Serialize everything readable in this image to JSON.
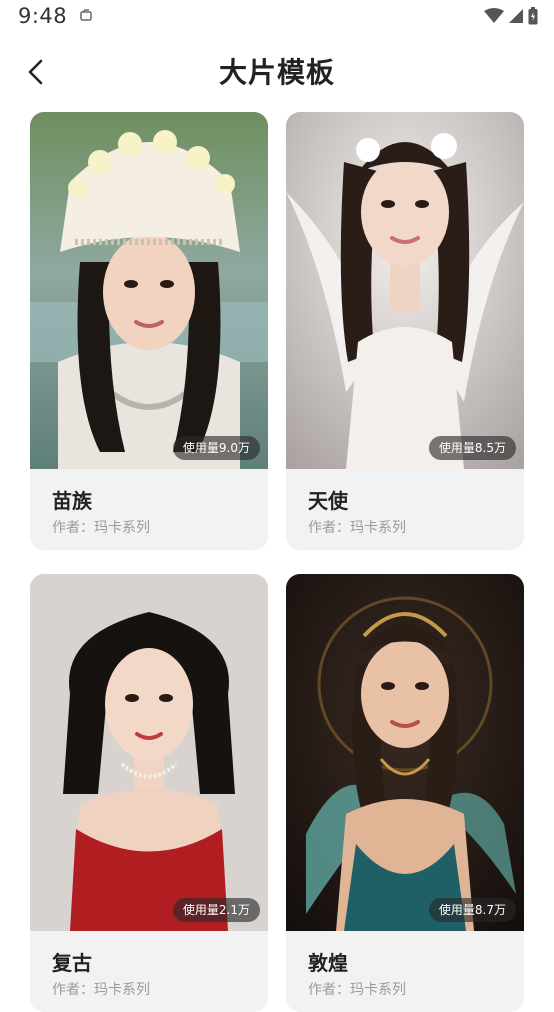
{
  "status_bar": {
    "time": "9:48",
    "icons": [
      "notification-icon",
      "wifi-icon",
      "signal-icon",
      "battery-icon"
    ]
  },
  "header": {
    "title": "大片模板",
    "back_icon": "chevron-left-icon"
  },
  "templates": [
    {
      "title": "苗族",
      "author": "作者：玛卡系列",
      "usage": "使用量9.0万"
    },
    {
      "title": "天使",
      "author": "作者：玛卡系列",
      "usage": "使用量8.5万"
    },
    {
      "title": "复古",
      "author": "作者：玛卡系列",
      "usage": "使用量2.1万"
    },
    {
      "title": "敦煌",
      "author": "作者：玛卡系列",
      "usage": "使用量8.7万"
    }
  ],
  "colors": {
    "card_bg": "#f2f2f2",
    "badge_bg": "#282828",
    "title": "#222222",
    "subtitle": "#9a9a9a"
  }
}
